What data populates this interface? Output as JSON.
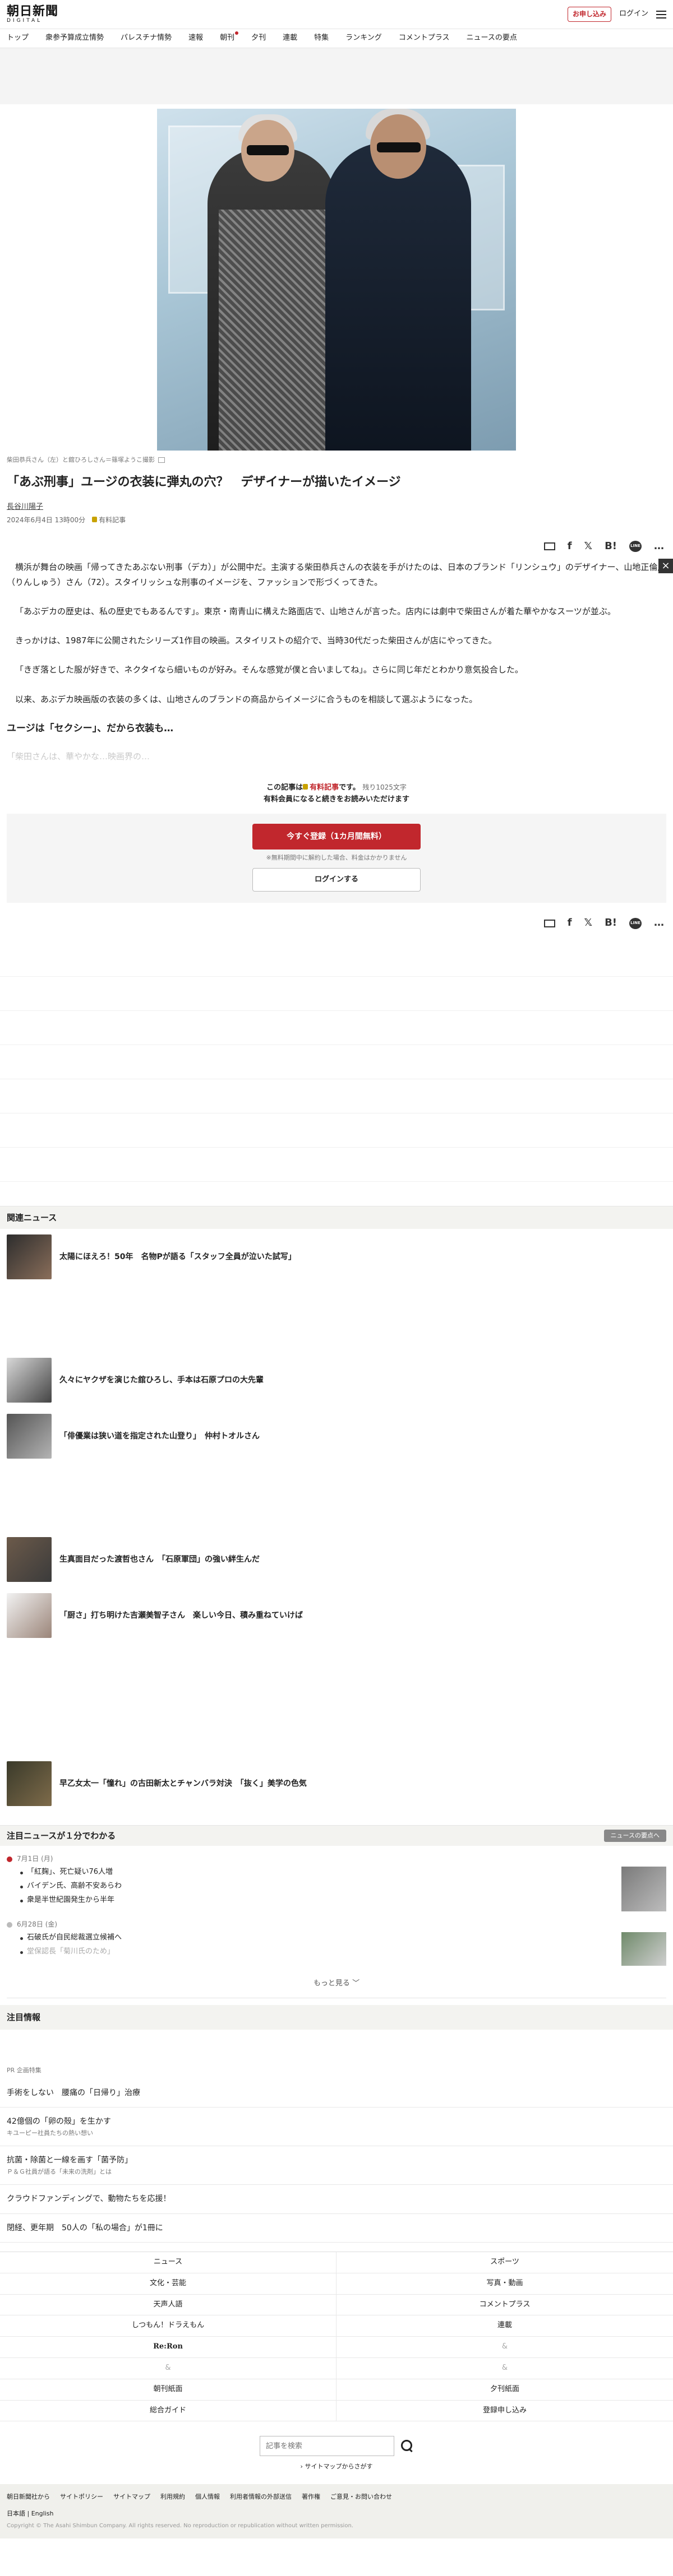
{
  "header": {
    "logo_jp": "朝日新聞",
    "logo_en": "DIGITAL",
    "apply_label": "お申し込み",
    "login_label": "ログイン"
  },
  "nav": {
    "items": [
      "トップ",
      "衆参予算成立情勢",
      "パレスチナ情勢",
      "速報",
      "朝刊",
      "夕刊",
      "連載",
      "特集",
      "ランキング",
      "コメントプラス",
      "ニュースの要点"
    ]
  },
  "photo": {
    "caption": "柴田恭兵さん（左）と舘ひろしさん＝篠塚ようこ撮影"
  },
  "article": {
    "title": "「あぶ刑事」ユージの衣装に弾丸の穴？　デザイナーが描いたイメージ",
    "author": "長谷川陽子",
    "date": "2024年6月4日 13時00分",
    "paid_label": "有料記事",
    "paragraphs": [
      "横浜が舞台の映画「帰ってきたあぶない刑事（デカ）」が公開中だ。主演する柴田恭兵さんの衣装を手がけたのは、日本のブランド「リンシュウ」のデザイナー、山地正倫周（りんしゅう）さん（72）。スタイリッシュな刑事のイメージを、ファッションで形づくってきた。",
      "「あぶデカの歴史は、私の歴史でもあるんです」。東京・南青山に構えた路面店で、山地さんが言った。店内には劇中で柴田さんが着た華やかなスーツが並ぶ。",
      "きっかけは、1987年に公開されたシリーズ1作目の映画。スタイリストの紹介で、当時30代だった柴田さんが店にやってきた。",
      "「きぎ落とした服が好きで、ネクタイなら細いものが好み。そんな感覚が僕と合いましてね」。さらに同じ年だとわかり意気投合した。",
      "以来、あぶデカ映画版の衣装の多くは、山地さんのブランドの商品からイメージに合うものを相談して選ぶようになった。"
    ],
    "subheading": "ユージは「セクシー」、だから衣装も…",
    "faded": "「柴田さんは、華やかな…映画界の…"
  },
  "share": {
    "hatena": "B!",
    "line": "LINE",
    "more": "…",
    "x": "𝕏",
    "facebook": "f"
  },
  "paywall": {
    "line1_pre": "この記事は",
    "line1_paid": "有料記事",
    "line1_post": "です。",
    "line1_rest": "残り1025文字",
    "line2": "有料会員になると続きをお読みいただけます",
    "register": "今すぐ登録（1カ月間無料）",
    "note": "※無料期間中に解約した場合、料金はかかりません",
    "login": "ログインする"
  },
  "related": {
    "heading": "関連ニュース",
    "items": [
      "太陽にほえろ！50年　名物Pが語る「スタッフ全員が泣いた試写」",
      "久々にヤクザを演じた舘ひろし、手本は石原プロの大先輩",
      "「俳優業は狭い道を指定された山登り」　仲村トオルさん",
      "生真面目だった渡哲也さん　「石原軍団」の強い絆生んだ",
      "「厨さ」打ち明けた吉瀬美智子さん　楽しい今日、積み重ねていけば",
      "早乙女太一「憧れ」の古田新太とチャンバラ対決　「抜く」美学の色気"
    ]
  },
  "digest": {
    "heading": "注目ニュースが１分でわかる",
    "button": "ニュースの要点へ",
    "day1": "7月1日 (月)",
    "day1_items": [
      "「紅麹」、死亡疑い76人増",
      "バイデン氏、高齢不安あらわ",
      "衆是半世紀園発生から半年"
    ],
    "day2": "6月28日 (金)",
    "day2_items": [
      "石破氏が自民総裁選立候補へ",
      "堂保認長「菊川氏のため」"
    ],
    "more": "もっと見る"
  },
  "attention": {
    "heading": "注目情報",
    "pr": "PR 企画特集",
    "items": [
      {
        "title": "手術をしない　腰痛の「日帰り」治療",
        "sub": ""
      },
      {
        "title": "42億個の「卵の殻」を生かす",
        "sub": "キユーピー社員たちの熱い想い"
      },
      {
        "title": "抗菌・除菌と一線を画す「菌予防」",
        "sub": "Ｐ＆Ｇ社員が語る「未来の洗剤」とは"
      },
      {
        "title": "クラウドファンディングで、動物たちを応援！",
        "sub": ""
      },
      {
        "title": "閉経、更年期　50人の「私の場合」が1冊に",
        "sub": ""
      }
    ]
  },
  "footer": {
    "grid": [
      "ニュース",
      "スポーツ",
      "文化・芸能",
      "写真・動画",
      "天声人語",
      "コメントプラス",
      "しつもん！ドラえもん",
      "連載",
      "Re:Ron",
      "&",
      "&",
      "&",
      "朝刊紙面",
      "夕刊紙面",
      "総合ガイド",
      "登録申し込み"
    ],
    "search_placeholder": "記事を検索",
    "sitemap": "サイトマップからさがす",
    "links": [
      "朝日新聞社から",
      "サイトポリシー",
      "サイトマップ",
      "利用規約",
      "個人情報",
      "利用者情報の外部送信",
      "著作権",
      "ご意見・お問い合わせ"
    ],
    "lang": "日本語 | English",
    "copyright": "Copyright © The Asahi Shimbun Company. All rights reserved. No reproduction or republication without written permission."
  }
}
